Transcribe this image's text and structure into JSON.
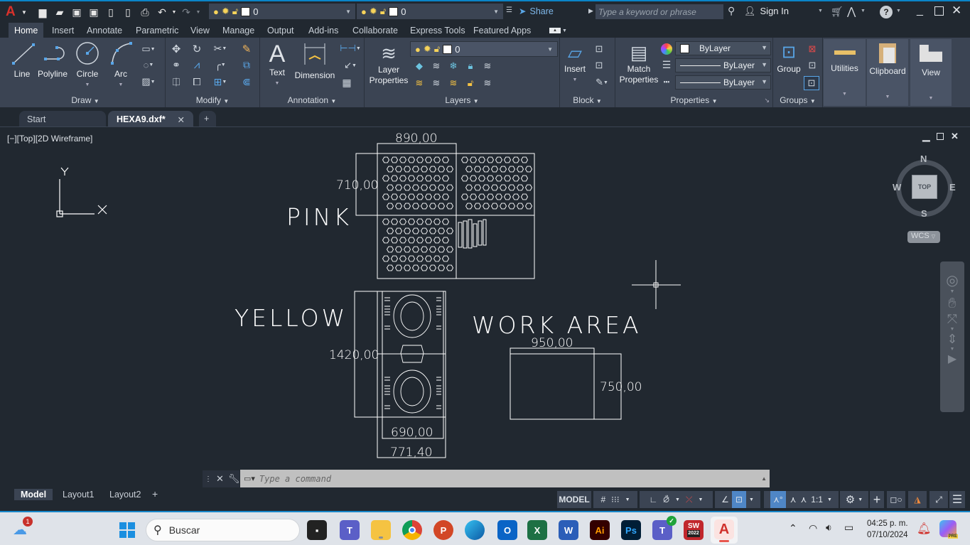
{
  "app": {
    "logo": "A",
    "qat_icons": [
      "new-icon",
      "open-icon",
      "save-icon",
      "save-as-icon",
      "open-from-web-icon",
      "save-to-web-icon",
      "plot-icon",
      "undo-icon",
      "redo-icon"
    ],
    "layer_combo": {
      "value": "0"
    },
    "layer_combo2": {
      "value": "0"
    },
    "share_label": "Share",
    "search_placeholder": "Type a keyword or phrase",
    "sign_in_label": "Sign In"
  },
  "ribbon_tabs": [
    {
      "label": "Home",
      "active": true
    },
    {
      "label": "Insert"
    },
    {
      "label": "Annotate"
    },
    {
      "label": "Parametric"
    },
    {
      "label": "View"
    },
    {
      "label": "Manage"
    },
    {
      "label": "Output"
    },
    {
      "label": "Add-ins"
    },
    {
      "label": "Collaborate"
    },
    {
      "label": "Express Tools"
    },
    {
      "label": "Featured Apps"
    }
  ],
  "ribbon": {
    "draw": {
      "title": "Draw",
      "line": "Line",
      "polyline": "Polyline",
      "circle": "Circle",
      "arc": "Arc"
    },
    "modify": {
      "title": "Modify"
    },
    "annotation": {
      "title": "Annotation",
      "text": "Text",
      "dimension": "Dimension"
    },
    "layers": {
      "title": "Layers",
      "layer_properties_1": "Layer",
      "layer_properties_2": "Properties",
      "current_layer": "0"
    },
    "block": {
      "title": "Block",
      "insert": "Insert"
    },
    "properties": {
      "title": "Properties",
      "match_1": "Match",
      "match_2": "Properties",
      "color": "ByLayer",
      "lineweight": "ByLayer",
      "linetype": "ByLayer"
    },
    "groups": {
      "title": "Groups",
      "group": "Group"
    },
    "utilities": "Utilities",
    "clipboard": "Clipboard",
    "view": "View"
  },
  "doc_tabs": [
    {
      "label": "Start"
    },
    {
      "label": "HEXA9.dxf*",
      "active": true
    }
  ],
  "viewport": {
    "label": "[−][Top][2D Wireframe]",
    "ucs_x": "X",
    "ucs_y": "Y",
    "viewcube": {
      "n": "N",
      "s": "S",
      "e": "E",
      "w": "W",
      "face": "TOP",
      "wcs": "WCS"
    }
  },
  "drawing": {
    "pink_label": "PINK",
    "yellow_label": "YELLOW",
    "work_area_label": "WORK AREA",
    "dims": {
      "pink_width": "890,00",
      "pink_height": "710,00",
      "yellow_height": "1420,00",
      "yellow_inner_width": "690,00",
      "yellow_outer_width": "771,40",
      "work_width": "950,00",
      "work_height": "750,00"
    }
  },
  "command": {
    "placeholder": "Type a command"
  },
  "layout_tabs": [
    {
      "label": "Model",
      "active": true
    },
    {
      "label": "Layout1"
    },
    {
      "label": "Layout2"
    }
  ],
  "status": {
    "model": "MODEL",
    "scale": "1:1"
  },
  "taskbar": {
    "search_label": "Buscar",
    "weather_badge": "1",
    "time": "04:25 p. m.",
    "date": "07/10/2024",
    "apps": [
      {
        "name": "task-view",
        "label": ""
      },
      {
        "name": "teams",
        "label": "T"
      },
      {
        "name": "file-explorer",
        "label": ""
      },
      {
        "name": "chrome",
        "label": ""
      },
      {
        "name": "powerpoint",
        "label": "P"
      },
      {
        "name": "edge",
        "label": ""
      },
      {
        "name": "outlook",
        "label": "O"
      },
      {
        "name": "excel",
        "label": "X"
      },
      {
        "name": "word",
        "label": "W"
      },
      {
        "name": "illustrator",
        "label": "Ai"
      },
      {
        "name": "photoshop",
        "label": "Ps"
      },
      {
        "name": "teams-work",
        "label": "T"
      },
      {
        "name": "solidworks",
        "label": "SW"
      },
      {
        "name": "autocad",
        "label": "A"
      }
    ],
    "solidworks_year": "2022",
    "copilot_badge": "PRE"
  }
}
